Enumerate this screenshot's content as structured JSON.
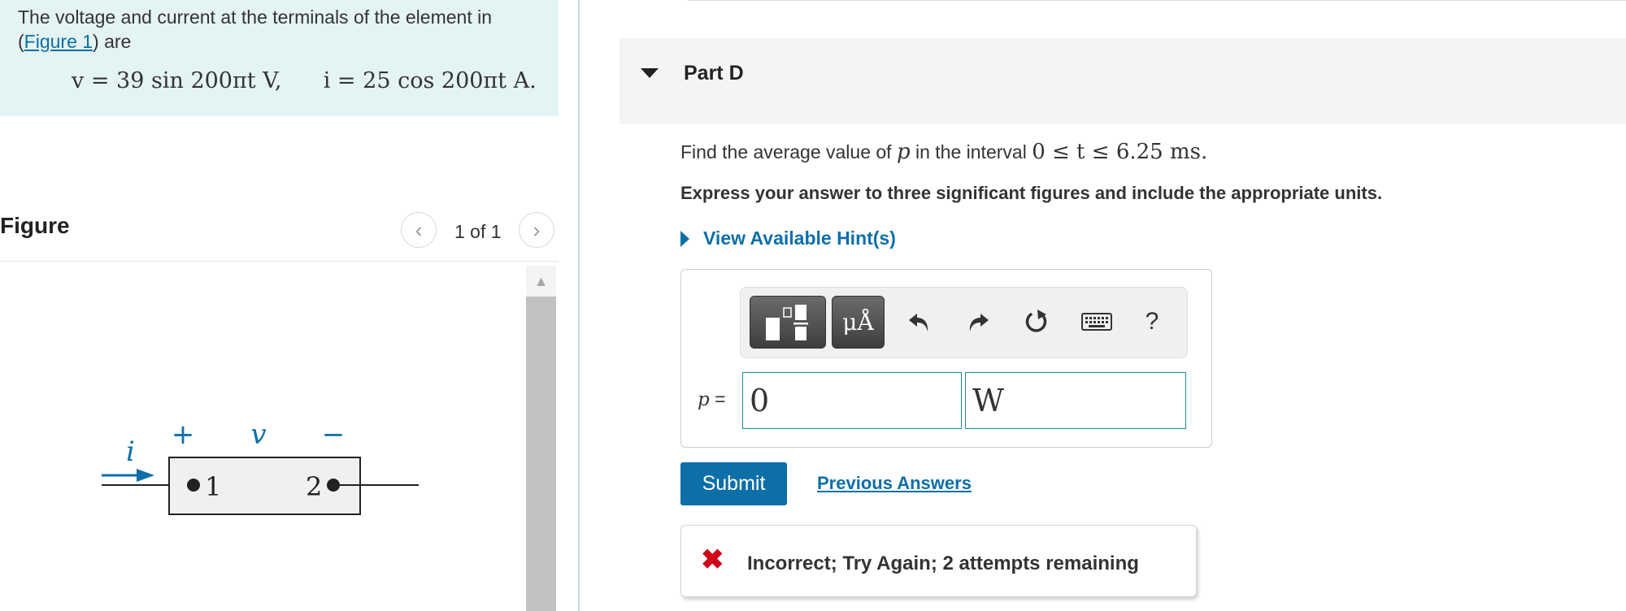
{
  "problem": {
    "text_before": "The voltage and current at the terminals of the element in (",
    "figure_link": "Figure 1",
    "text_after": ") are",
    "equation_v": "v = 39 sin 200πt V,",
    "equation_i": "i = 25 cos 200πt A."
  },
  "figure": {
    "title": "Figure",
    "prev": "‹",
    "counter": "1 of 1",
    "next": "›",
    "circuit_labels": {
      "current": "i",
      "plus": "+",
      "voltage": "v",
      "minus": "−",
      "terminal_1": "1",
      "terminal_2": "2"
    }
  },
  "part": {
    "title": "Part D",
    "question_before": "Find the average value of ",
    "question_var": "p",
    "question_mid": " in the interval ",
    "question_interval": "0 ≤ t ≤ 6.25 ms.",
    "instruction": "Express your answer to three significant figures and include the appropriate units.",
    "hint": "View Available Hint(s)"
  },
  "answer": {
    "variable": "p",
    "equals": " =",
    "value": "0",
    "unit": "W"
  },
  "toolbar": {
    "units_symbol": "μÅ",
    "help": "?",
    "icons": [
      "templates-icon",
      "units-icon",
      "undo-icon",
      "redo-icon",
      "reset-icon",
      "keyboard-icon",
      "help-icon"
    ]
  },
  "actions": {
    "submit": "Submit",
    "previous_answers": "Previous Answers"
  },
  "feedback": {
    "icon": "✖",
    "text": "Incorrect; Try Again; 2 attempts remaining",
    "color": "#d0021b"
  },
  "colors": {
    "accent": "#0d6fa8",
    "intro_bg": "#e4f4f4",
    "part_header_bg": "#f4f4f4"
  }
}
